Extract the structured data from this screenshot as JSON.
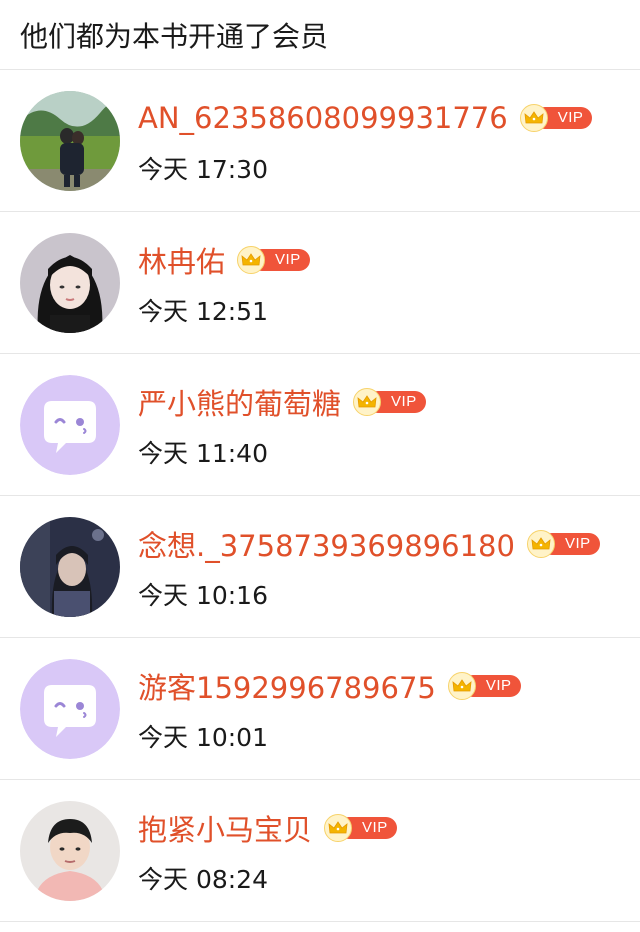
{
  "header": {
    "title": "他们都为本书开通了会员"
  },
  "members": [
    {
      "name": "AN_62358608099931776",
      "vip": "VIP",
      "time": "今天 17:30",
      "avatar": "photo-couple-field"
    },
    {
      "name": "林冉佑",
      "vip": "VIP",
      "time": "今天 12:51",
      "avatar": "photo-girl-dark-hair"
    },
    {
      "name": "严小熊的葡萄糖",
      "vip": "VIP",
      "time": "今天 11:40",
      "avatar": "default-chat-bubble"
    },
    {
      "name": "念想._3758739369896180",
      "vip": "VIP",
      "time": "今天 10:16",
      "avatar": "photo-girl-night"
    },
    {
      "name": "游客1592996789675",
      "vip": "VIP",
      "time": "今天 10:01",
      "avatar": "default-chat-bubble"
    },
    {
      "name": "抱紧小马宝贝",
      "vip": "VIP",
      "time": "今天 08:24",
      "avatar": "photo-boy-pink"
    }
  ],
  "colors": {
    "name": "#e0502a",
    "vip_badge": "#f0543a",
    "default_avatar_bg": "#d9c8f7",
    "divider": "#e6e6e6"
  }
}
